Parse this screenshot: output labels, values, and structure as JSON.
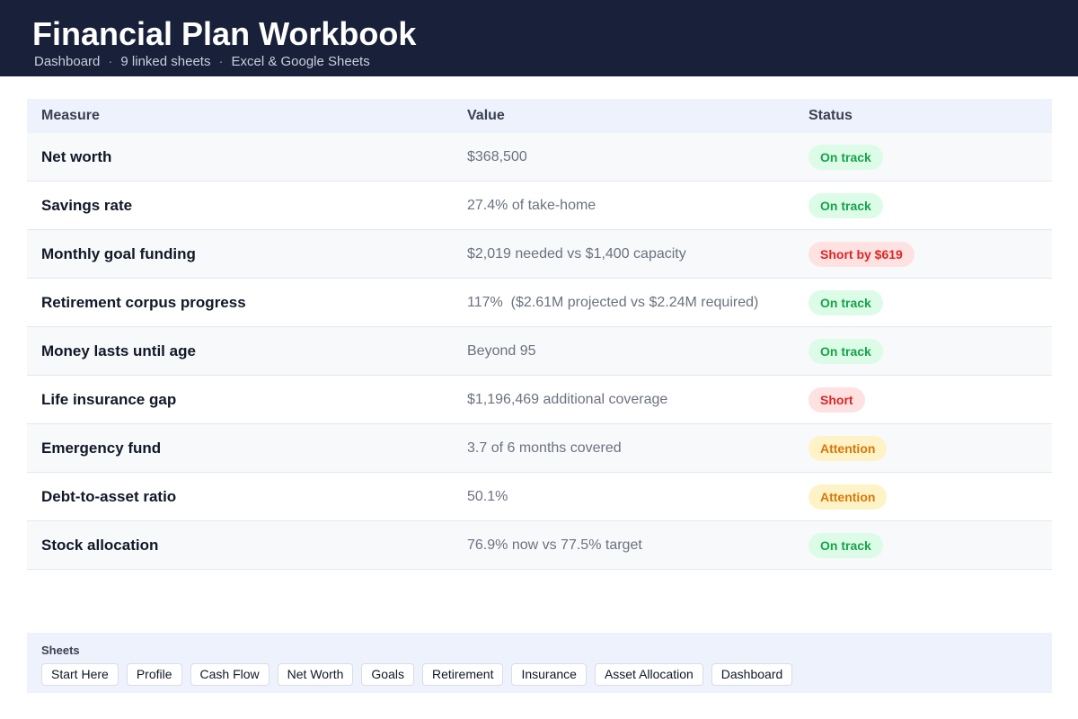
{
  "header": {
    "title": "Financial Plan Workbook",
    "subtitle_parts": [
      "Dashboard",
      "9 linked sheets",
      "Excel & Google Sheets"
    ],
    "separator": "·"
  },
  "table": {
    "columns": [
      "Measure",
      "Value",
      "Status"
    ],
    "rows": [
      {
        "measure": "Net worth",
        "value": "$368,500",
        "status": "On track",
        "status_type": "ok"
      },
      {
        "measure": "Savings rate",
        "value": "27.4% of take-home",
        "status": "On track",
        "status_type": "ok"
      },
      {
        "measure": "Monthly goal funding",
        "value": "$2,019 needed vs $1,400 capacity",
        "status": "Short by $619",
        "status_type": "bad"
      },
      {
        "measure": "Retirement corpus progress",
        "value": "117%  ($2.61M projected vs $2.24M required)",
        "status": "On track",
        "status_type": "ok"
      },
      {
        "measure": "Money lasts until age",
        "value": "Beyond 95",
        "status": "On track",
        "status_type": "ok"
      },
      {
        "measure": "Life insurance gap",
        "value": "$1,196,469 additional coverage",
        "status": "Short",
        "status_type": "bad"
      },
      {
        "measure": "Emergency fund",
        "value": "3.7 of 6 months covered",
        "status": "Attention",
        "status_type": "warn"
      },
      {
        "measure": "Debt-to-asset ratio",
        "value": "50.1%",
        "status": "Attention",
        "status_type": "warn"
      },
      {
        "measure": "Stock allocation",
        "value": "76.9% now vs 77.5% target",
        "status": "On track",
        "status_type": "ok"
      }
    ]
  },
  "sheets": {
    "label": "Sheets",
    "tabs": [
      "Start Here",
      "Profile",
      "Cash Flow",
      "Net Worth",
      "Goals",
      "Retirement",
      "Insurance",
      "Asset Allocation",
      "Dashboard"
    ]
  },
  "colors": {
    "header_bg": "#18203a",
    "ok": "#16a34a",
    "bad": "#dc2626",
    "warn": "#d97706"
  }
}
